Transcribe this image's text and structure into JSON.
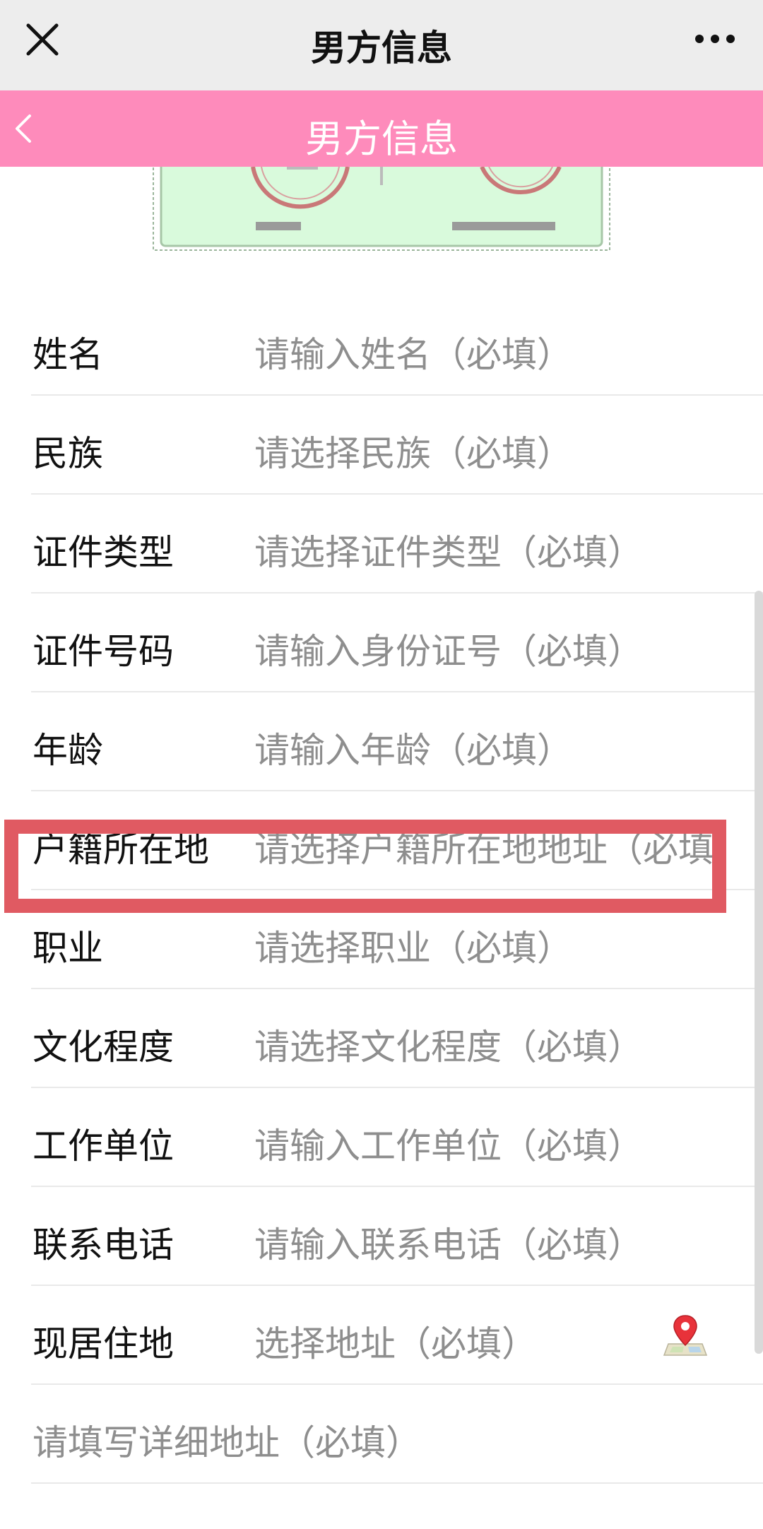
{
  "topbar": {
    "title": "男方信息",
    "close_icon": "close-icon",
    "more_icon": "more-icon"
  },
  "header": {
    "title": "男方信息",
    "back_icon": "chevron-left-icon",
    "background": "#fe8bbb"
  },
  "form": {
    "rows": [
      {
        "label": "姓名",
        "placeholder": "请输入姓名（必填）"
      },
      {
        "label": "民族",
        "placeholder": "请选择民族（必填）"
      },
      {
        "label": "证件类型",
        "placeholder": "请选择证件类型（必填）"
      },
      {
        "label": "证件号码",
        "placeholder": "请输入身份证号（必填）"
      },
      {
        "label": "年龄",
        "placeholder": "请输入年龄（必填）"
      },
      {
        "label": "户籍所在地",
        "placeholder": "请选择户籍所在地地址（必填"
      },
      {
        "label": "职业",
        "placeholder": "请选择职业（必填）"
      },
      {
        "label": "文化程度",
        "placeholder": "请选择文化程度（必填）"
      },
      {
        "label": "工作单位",
        "placeholder": "请输入工作单位（必填）"
      },
      {
        "label": "联系电话",
        "placeholder": "请输入联系电话（必填）"
      },
      {
        "label": "现居住地",
        "placeholder": "选择地址（必填）",
        "icon": "map-pin-icon"
      }
    ],
    "detail_placeholder": "请填写详细地址（必填）"
  },
  "highlight_color": "#e05a62"
}
